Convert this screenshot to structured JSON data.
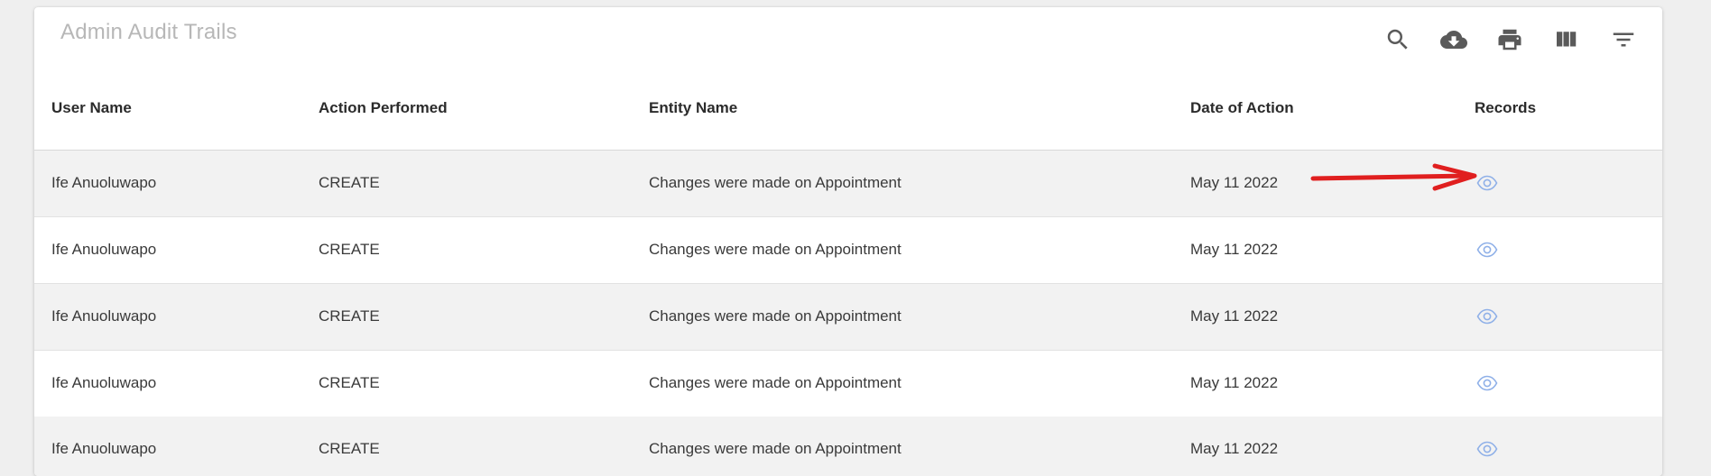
{
  "toolbar": {
    "title": "Admin Audit Trails",
    "icons": [
      "search-icon",
      "cloud-download-icon",
      "print-icon",
      "view-columns-icon",
      "filter-icon"
    ]
  },
  "table": {
    "columns": [
      "User Name",
      "Action Performed",
      "Entity Name",
      "Date of Action",
      "Records"
    ],
    "rows": [
      {
        "user": "Ife Anuoluwapo",
        "action": "CREATE",
        "entity": "Changes were made on Appointment",
        "date": "May 11 2022"
      },
      {
        "user": "Ife Anuoluwapo",
        "action": "CREATE",
        "entity": "Changes were made on Appointment",
        "date": "May 11 2022"
      },
      {
        "user": "Ife Anuoluwapo",
        "action": "CREATE",
        "entity": "Changes were made on Appointment",
        "date": "May 11 2022"
      },
      {
        "user": "Ife Anuoluwapo",
        "action": "CREATE",
        "entity": "Changes were made on Appointment",
        "date": "May 11 2022"
      },
      {
        "user": "Ife Anuoluwapo",
        "action": "CREATE",
        "entity": "Changes were made on Appointment",
        "date": "May 11 2022"
      }
    ]
  },
  "colors": {
    "eye_icon": "#8fb0e8",
    "annotation_arrow": "#e01f1f",
    "alt_row": "#f2f2f2"
  }
}
